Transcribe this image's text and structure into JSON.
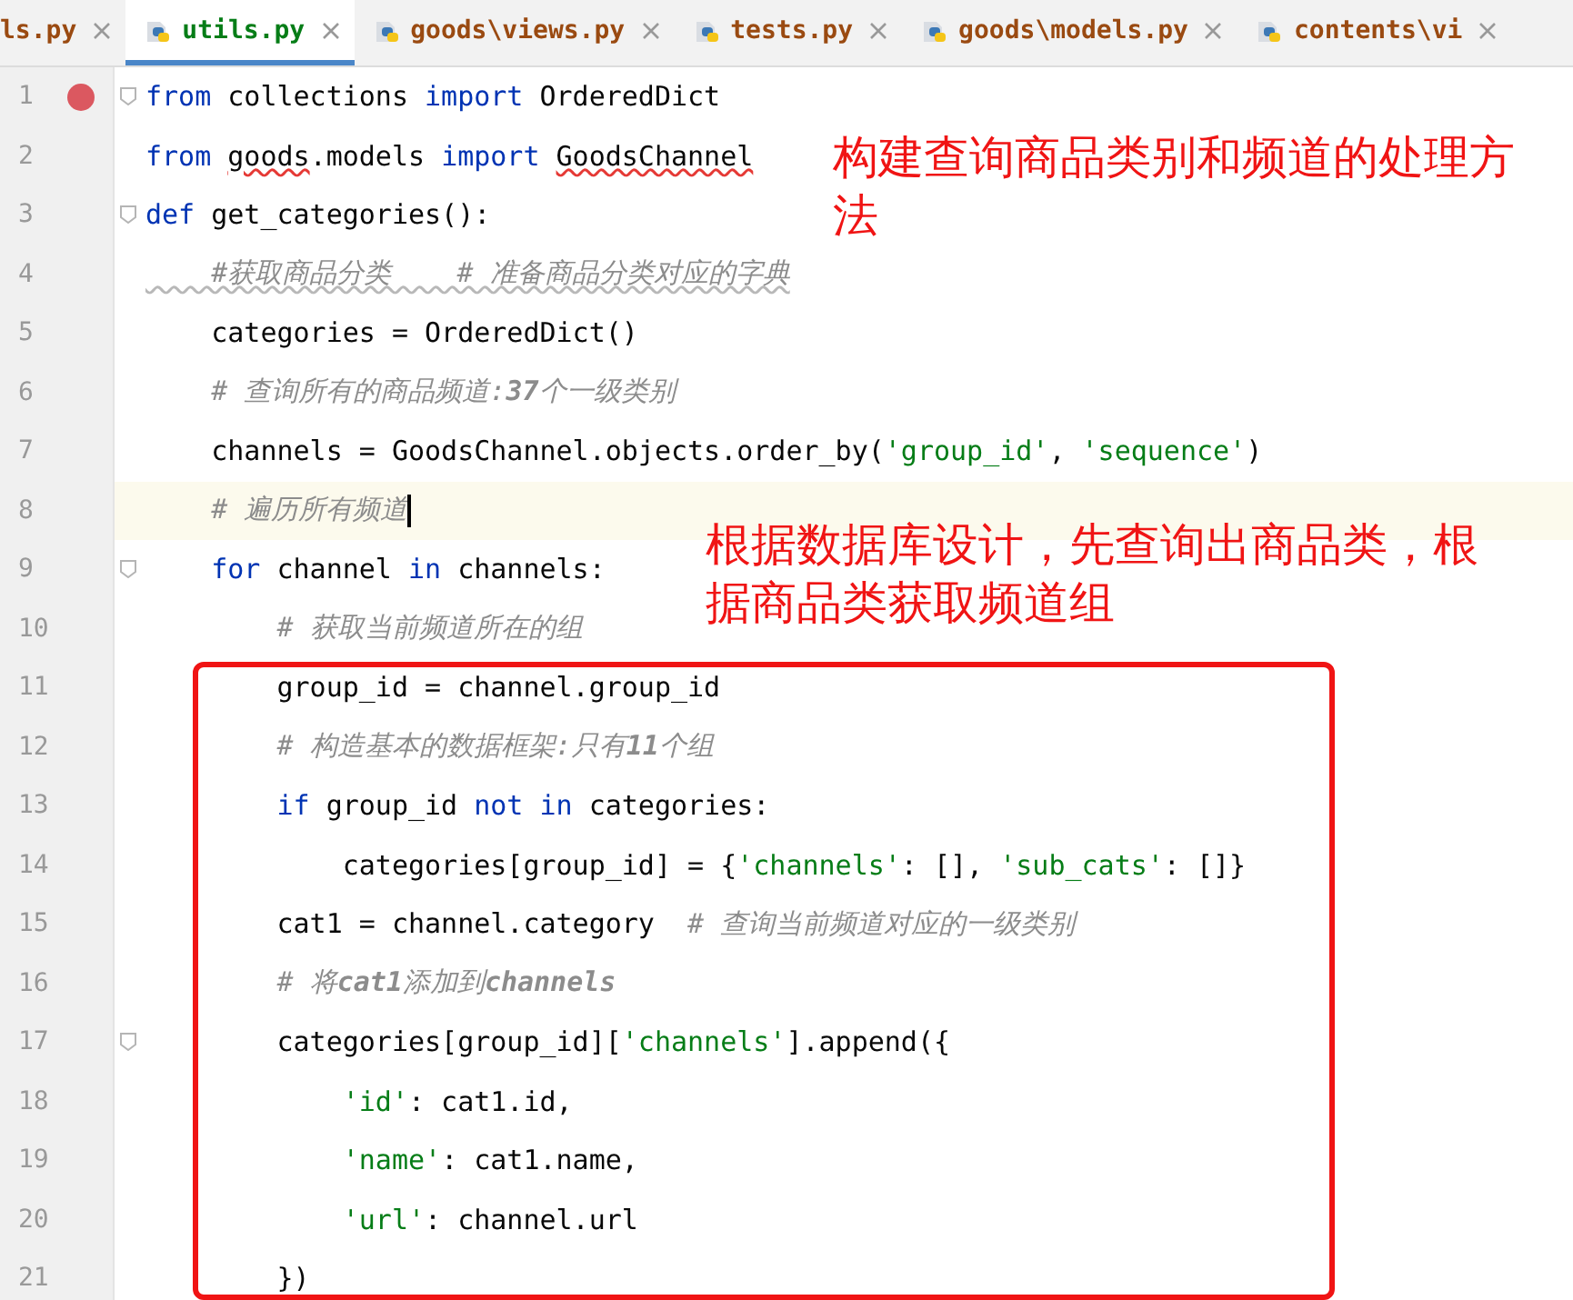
{
  "tabs": [
    {
      "label": "ls.py",
      "selected": false
    },
    {
      "label": "utils.py",
      "selected": true
    },
    {
      "label": "goods\\views.py",
      "selected": false
    },
    {
      "label": "tests.py",
      "selected": false
    },
    {
      "label": "goods\\models.py",
      "selected": false
    },
    {
      "label": "contents\\vi",
      "selected": false
    }
  ],
  "lines": [
    {
      "number": "1",
      "breakpoint": true,
      "current": false,
      "fold": true,
      "tokens": [
        {
          "kind": "kw",
          "text": "from"
        },
        {
          "kind": "plain",
          "text": " collections "
        },
        {
          "kind": "kw",
          "text": "import"
        },
        {
          "kind": "plain",
          "text": " OrderedDict"
        }
      ]
    },
    {
      "number": "2",
      "breakpoint": false,
      "current": false,
      "fold": false,
      "tokens": [
        {
          "kind": "kw",
          "text": "from "
        },
        {
          "kind": "err",
          "text": "goods"
        },
        {
          "kind": "plain",
          "text": ".models "
        },
        {
          "kind": "kw",
          "text": "import "
        },
        {
          "kind": "err",
          "text": "GoodsChannel"
        }
      ]
    },
    {
      "number": "3",
      "breakpoint": false,
      "current": false,
      "fold": true,
      "tokens": [
        {
          "kind": "kw",
          "text": "def"
        },
        {
          "kind": "plain",
          "text": " get_categories():"
        }
      ]
    },
    {
      "number": "4",
      "breakpoint": false,
      "current": false,
      "fold": false,
      "tokens": [
        {
          "kind": "typo",
          "text": "    #获取商品分类    # 准备商品分类对应的字典"
        }
      ]
    },
    {
      "number": "5",
      "breakpoint": false,
      "current": false,
      "fold": false,
      "tokens": [
        {
          "kind": "plain",
          "text": "    categories = OrderedDict()"
        }
      ]
    },
    {
      "number": "6",
      "breakpoint": false,
      "current": false,
      "fold": false,
      "tokens": [
        {
          "kind": "com",
          "text": "    # 查询所有的商品频道:**37**个一级类别"
        }
      ]
    },
    {
      "number": "7",
      "breakpoint": false,
      "current": false,
      "fold": false,
      "tokens": [
        {
          "kind": "plain",
          "text": "    channels = GoodsChannel.objects.order_by("
        },
        {
          "kind": "str",
          "text": "'group_id'"
        },
        {
          "kind": "plain",
          "text": ", "
        },
        {
          "kind": "str",
          "text": "'sequence'"
        },
        {
          "kind": "plain",
          "text": ")"
        }
      ]
    },
    {
      "number": "8",
      "breakpoint": false,
      "current": true,
      "fold": false,
      "tokens": [
        {
          "kind": "com",
          "text": "    # 遍历所有频道"
        }
      ]
    },
    {
      "number": "9",
      "breakpoint": false,
      "current": false,
      "fold": true,
      "tokens": [
        {
          "kind": "kw",
          "text": "    for"
        },
        {
          "kind": "plain",
          "text": " channel "
        },
        {
          "kind": "kw",
          "text": "in"
        },
        {
          "kind": "plain",
          "text": " channels:"
        }
      ]
    },
    {
      "number": "10",
      "breakpoint": false,
      "current": false,
      "fold": false,
      "tokens": [
        {
          "kind": "com",
          "text": "        # 获取当前频道所在的组"
        }
      ]
    },
    {
      "number": "11",
      "breakpoint": false,
      "current": false,
      "fold": false,
      "tokens": [
        {
          "kind": "plain",
          "text": "        group_id = channel.group_id"
        }
      ]
    },
    {
      "number": "12",
      "breakpoint": false,
      "current": false,
      "fold": false,
      "tokens": [
        {
          "kind": "com",
          "text": "        # 构造基本的数据框架:只有**11**个组"
        }
      ]
    },
    {
      "number": "13",
      "breakpoint": false,
      "current": false,
      "fold": false,
      "tokens": [
        {
          "kind": "kw",
          "text": "        if"
        },
        {
          "kind": "plain",
          "text": " group_id "
        },
        {
          "kind": "kw",
          "text": "not in"
        },
        {
          "kind": "plain",
          "text": " categories:"
        }
      ]
    },
    {
      "number": "14",
      "breakpoint": false,
      "current": false,
      "fold": false,
      "tokens": [
        {
          "kind": "plain",
          "text": "            categories[group_id] = {"
        },
        {
          "kind": "str",
          "text": "'channels'"
        },
        {
          "kind": "plain",
          "text": ": [], "
        },
        {
          "kind": "str",
          "text": "'sub_cats'"
        },
        {
          "kind": "plain",
          "text": ": []}"
        }
      ]
    },
    {
      "number": "15",
      "breakpoint": false,
      "current": false,
      "fold": false,
      "tokens": [
        {
          "kind": "plain",
          "text": "        cat1 = channel.category  "
        },
        {
          "kind": "com",
          "text": "# 查询当前频道对应的一级类别"
        }
      ]
    },
    {
      "number": "16",
      "breakpoint": false,
      "current": false,
      "fold": false,
      "tokens": [
        {
          "kind": "com",
          "text": "        # 将**cat1**添加到**channels**"
        }
      ]
    },
    {
      "number": "17",
      "breakpoint": false,
      "current": false,
      "fold": true,
      "tokens": [
        {
          "kind": "plain",
          "text": "        categories[group_id]["
        },
        {
          "kind": "str",
          "text": "'channels'"
        },
        {
          "kind": "plain",
          "text": "].append({"
        }
      ]
    },
    {
      "number": "18",
      "breakpoint": false,
      "current": false,
      "fold": false,
      "tokens": [
        {
          "kind": "str",
          "text": "            'id'"
        },
        {
          "kind": "plain",
          "text": ": cat1.id,"
        }
      ]
    },
    {
      "number": "19",
      "breakpoint": false,
      "current": false,
      "fold": false,
      "tokens": [
        {
          "kind": "str",
          "text": "            'name'"
        },
        {
          "kind": "plain",
          "text": ": cat1.name,"
        }
      ]
    },
    {
      "number": "20",
      "breakpoint": false,
      "current": false,
      "fold": false,
      "tokens": [
        {
          "kind": "str",
          "text": "            'url'"
        },
        {
          "kind": "plain",
          "text": ": channel.url"
        }
      ]
    },
    {
      "number": "21",
      "breakpoint": false,
      "current": false,
      "fold": false,
      "tokens": [
        {
          "kind": "plain",
          "text": "        })"
        }
      ]
    }
  ],
  "annotations": [
    {
      "text": "构建查询商品类别和频道的处理方法"
    },
    {
      "text": "根据数据库设计，先查询出商品类，根据商品类获取频道组"
    }
  ]
}
